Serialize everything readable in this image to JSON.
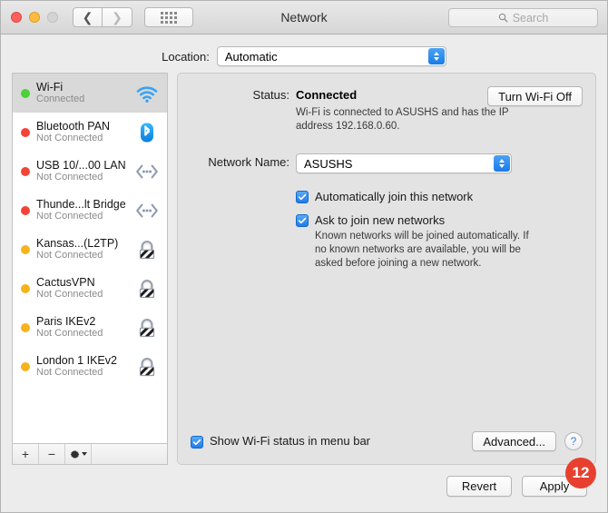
{
  "window": {
    "title": "Network",
    "traffic_lights": [
      "close",
      "minimize",
      "zoom-disabled"
    ],
    "back_icon": "chevron-left-icon",
    "forward_icon": "chevron-right-icon",
    "grid_icon": "grid-view-icon"
  },
  "search": {
    "placeholder": "Search",
    "icon": "search-icon"
  },
  "location": {
    "label": "Location:",
    "value": "Automatic",
    "options": [
      "Automatic"
    ]
  },
  "sidebar": {
    "items": [
      {
        "name": "Wi-Fi",
        "status": "Connected",
        "dot": "green",
        "icon": "wifi-icon",
        "selected": true
      },
      {
        "name": "Bluetooth PAN",
        "status": "Not Connected",
        "dot": "red",
        "icon": "bluetooth-icon",
        "selected": false
      },
      {
        "name": "USB 10/...00 LAN",
        "status": "Not Connected",
        "dot": "red",
        "icon": "ethernet-icon",
        "selected": false
      },
      {
        "name": "Thunde...lt Bridge",
        "status": "Not Connected",
        "dot": "red",
        "icon": "ethernet-icon",
        "selected": false
      },
      {
        "name": "Kansas...(L2TP)",
        "status": "Not Connected",
        "dot": "orange",
        "icon": "vpn-lock-icon",
        "selected": false
      },
      {
        "name": "CactusVPN",
        "status": "Not Connected",
        "dot": "orange",
        "icon": "vpn-lock-icon",
        "selected": false
      },
      {
        "name": "Paris IKEv2",
        "status": "Not Connected",
        "dot": "orange",
        "icon": "vpn-lock-icon",
        "selected": false
      },
      {
        "name": "London 1 IKEv2",
        "status": "Not Connected",
        "dot": "orange",
        "icon": "vpn-lock-icon",
        "selected": false
      }
    ],
    "toolbar": {
      "add_label": "+",
      "remove_label": "−",
      "actions_icon": "gear-icon"
    }
  },
  "main": {
    "status_label": "Status:",
    "status_value": "Connected",
    "status_description": "Wi-Fi is connected to ASUSHS and has the IP address 192.168.0.60.",
    "turn_wifi_off_label": "Turn Wi-Fi Off",
    "network_name_label": "Network Name:",
    "network_name_value": "ASUSHS",
    "auto_join_label": "Automatically join this network",
    "auto_join_checked": true,
    "ask_join_label": "Ask to join new networks",
    "ask_join_checked": true,
    "ask_join_help": "Known networks will be joined automatically. If no known networks are available, you will be asked before joining a new network.",
    "show_menubar_label": "Show Wi-Fi status in menu bar",
    "show_menubar_checked": true,
    "advanced_label": "Advanced...",
    "help_label": "?"
  },
  "footer": {
    "revert_label": "Revert",
    "apply_label": "Apply"
  },
  "annotation": {
    "badge_number": "12",
    "badge_color": "#e8402f"
  }
}
